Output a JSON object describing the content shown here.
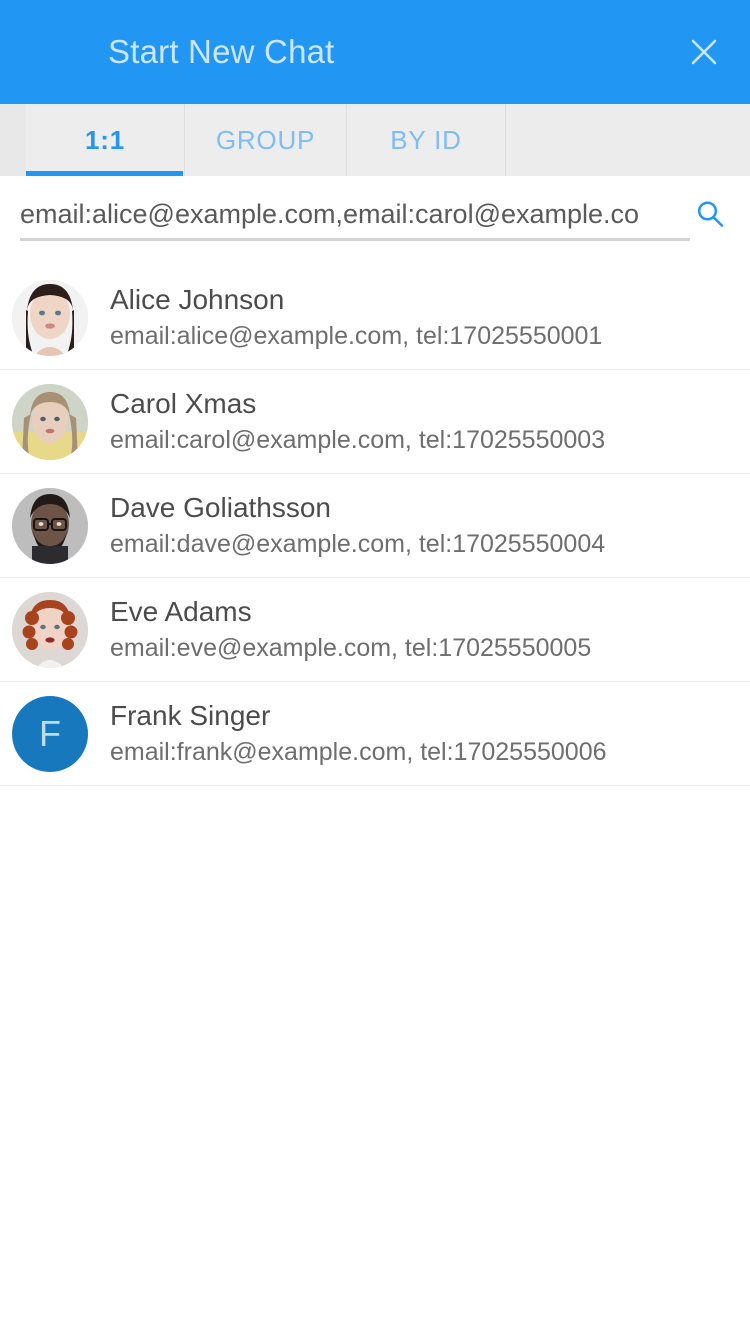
{
  "theme": {
    "header_bg": "#2196f3",
    "header_title_color": "#cbe6fb",
    "accent": "#2196f3",
    "tab_inactive": "#7ebcf5",
    "tabbar_bg": "#ececec",
    "name_color": "#4c4c4c",
    "sub_color": "#6e6e6e",
    "divider": "#ededed",
    "initial_avatar_bg": "#1878bd",
    "initial_avatar_fg": "#bcdcf3"
  },
  "header": {
    "title": "Start New Chat",
    "close_icon": "close-icon",
    "close_label": "✕"
  },
  "tabs": [
    {
      "label": "1:1",
      "active": true
    },
    {
      "label": "GROUP",
      "active": false
    },
    {
      "label": "BY ID",
      "active": false
    }
  ],
  "search": {
    "value": "email:alice@example.com,email:carol@example.co",
    "placeholder": "Search",
    "icon": "search-icon"
  },
  "contacts": [
    {
      "name": "Alice Johnson",
      "detail": "email:alice@example.com, tel:17025550001",
      "avatar_type": "photo",
      "avatar_tone": "#efd5c6",
      "avatar_hair": "#2a1d1a",
      "avatar_bg": "#f2f2f2"
    },
    {
      "name": "Carol Xmas",
      "detail": "email:carol@example.com, tel:17025550003",
      "avatar_type": "photo",
      "avatar_tone": "#e8cfbd",
      "avatar_hair": "#a79074",
      "avatar_bg": "#cfd4c8"
    },
    {
      "name": "Dave Goliathsson",
      "detail": "email:dave@example.com, tel:17025550004",
      "avatar_type": "photo",
      "avatar_tone": "#6d5447",
      "avatar_hair": "#211a18",
      "avatar_bg": "#bdbdbd"
    },
    {
      "name": "Eve Adams",
      "detail": "email:eve@example.com, tel:17025550005",
      "avatar_type": "photo",
      "avatar_tone": "#f0d3c4",
      "avatar_hair": "#a8441d",
      "avatar_bg": "#ddd8d4"
    },
    {
      "name": "Frank Singer",
      "detail": "email:frank@example.com, tel:17025550006",
      "avatar_type": "initial",
      "avatar_initial": "F"
    }
  ]
}
